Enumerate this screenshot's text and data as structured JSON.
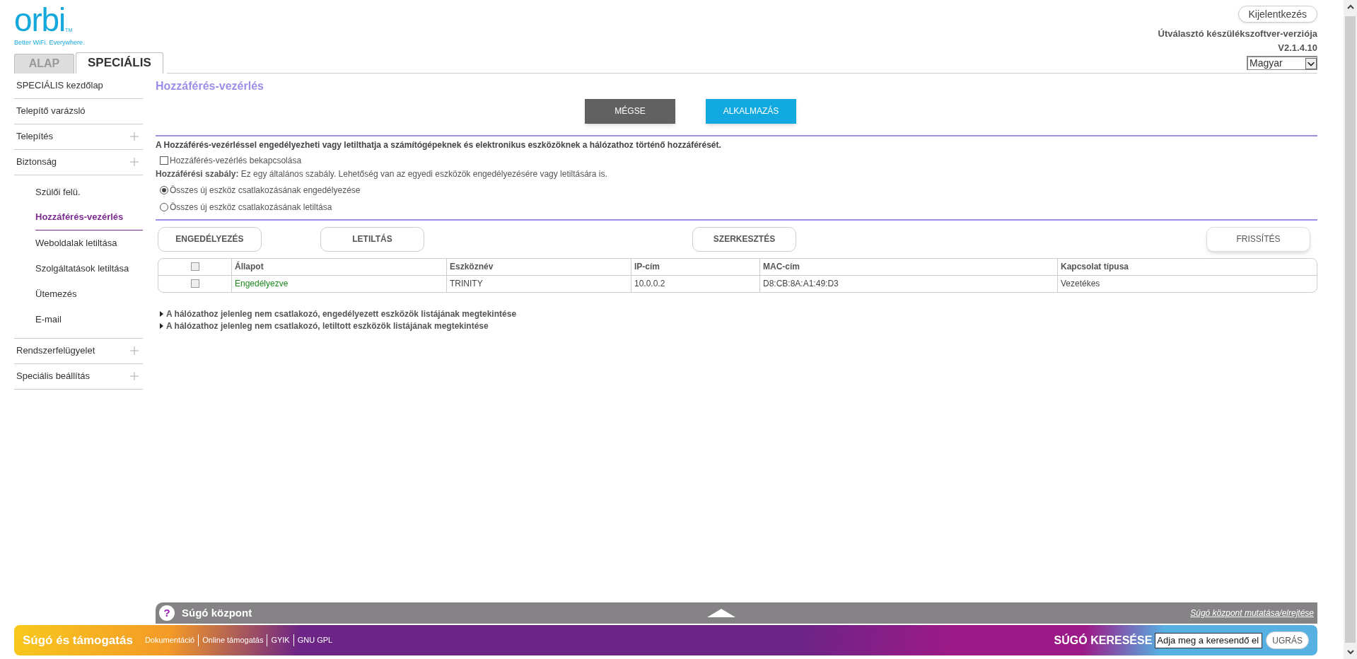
{
  "logo": {
    "wordmark": "orbi",
    "tm": "TM",
    "tagline": "Better WiFi. Everywhere."
  },
  "tabs": [
    {
      "label": "ALAP",
      "selected": false
    },
    {
      "label": "SPECIÁLIS",
      "selected": true
    }
  ],
  "logout_button": "Kijelentkezés",
  "firmware": {
    "label": "Útválasztó készülékszoftver-verziója",
    "version": "V2.1.4.10"
  },
  "language_select": {
    "value": "Magyar"
  },
  "sidebar": {
    "items": [
      {
        "label": "SPECIÁLIS kezdőlap",
        "expandable": false,
        "selected": false
      },
      {
        "label": "Telepítő varázsló",
        "expandable": false,
        "selected": false
      },
      {
        "label": "Telepítés",
        "expandable": true,
        "selected": false
      },
      {
        "label": "Biztonság",
        "expandable": true,
        "selected": false,
        "children": [
          {
            "label": "Szülői felü.",
            "selected": false
          },
          {
            "label": "Hozzáférés-vezérlés",
            "selected": true
          },
          {
            "label": "Weboldalak letiltása",
            "selected": false
          },
          {
            "label": "Szolgáltatások letiltása",
            "selected": false
          },
          {
            "label": "Ütemezés",
            "selected": false
          },
          {
            "label": "E-mail",
            "selected": false
          }
        ]
      },
      {
        "label": "Rendszerfelügyelet",
        "expandable": true,
        "selected": false
      },
      {
        "label": "Speciális beállítás",
        "expandable": true,
        "selected": false
      }
    ]
  },
  "page_title": "Hozzáférés-vezérlés",
  "buttons": [
    {
      "label": "MÉGSE",
      "kind": "secondary"
    },
    {
      "label": "ALKALMAZÁS",
      "kind": "primary"
    }
  ],
  "description": "A Hozzáférés-vezérléssel engedélyezheti vagy letilthatja a számítógépeknek és elektronikus eszközöknek a hálózathoz történő hozzáférését.",
  "enable_checkbox": {
    "label": "Hozzáférés-vezérlés bekapcsolása",
    "checked": false
  },
  "rule": "**Hozzáférési szabály:** Ez egy általános szabály. Lehetőség van az egyedi eszközök engedélyezésére vagy letiltására is.",
  "radios": [
    {
      "label": "Összes új eszköz csatlakozásának engedélyezése",
      "selected": true
    },
    {
      "label": "Összes új eszköz csatlakozásának letiltása",
      "selected": false
    }
  ],
  "action_buttons": [
    "ENGEDÉLYEZÉS",
    "LETILTÁS",
    "SZERKESZTÉS"
  ],
  "refresh_button": "FRISSÍTÉS",
  "table": {
    "header_checked": false,
    "columns": [
      "Állapot",
      "Eszköznév",
      "IP-cím",
      "MAC-cím",
      "Kapcsolat típusa"
    ],
    "rows": [
      {
        "checked": false,
        "allowed": true,
        "cells": [
          "Engedélyezve",
          "TRINITY",
          "10.0.0.2",
          "D8:CB:8A:A1:49:D3",
          "Vezetékes"
        ]
      }
    ]
  },
  "expanders": [
    "A hálózathoz jelenleg nem csatlakozó, engedélyezett eszközök listájának megtekintése",
    "A hálózathoz jelenleg nem csatlakozó, letiltott eszközök listájának megtekintése"
  ],
  "help_bar": {
    "icon": "?",
    "title": "Súgó központ",
    "toggle_link": "Súgó központ mutatása/elrejtése"
  },
  "support": {
    "title": "Súgó és támogatás",
    "links": [
      "Dokumentáció",
      "Online támogatás",
      "GYIK",
      "GNU GPL"
    ],
    "search_label": "SÚGÓ KERESÉSE",
    "search_value": "Adja meg a keresendő el",
    "go_button": "UGRÁS"
  }
}
